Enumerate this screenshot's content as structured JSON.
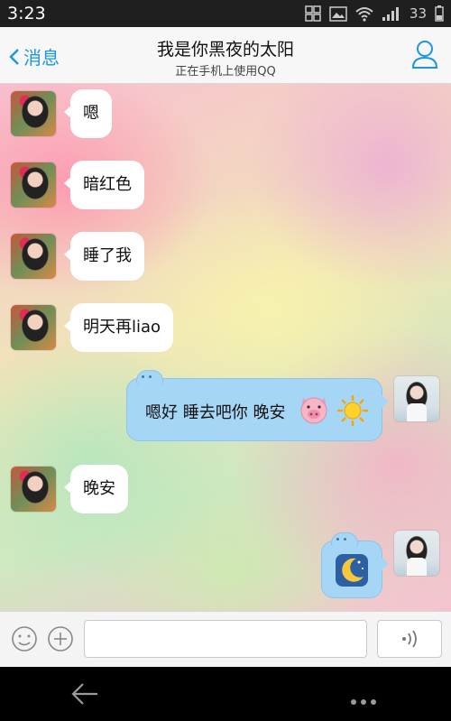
{
  "status_bar": {
    "time": "3:23",
    "battery": "33"
  },
  "header": {
    "back_label": "消息",
    "title": "我是你黑夜的太阳",
    "subtitle": "正在手机上使用QQ",
    "accent_color": "#1b95e0"
  },
  "messages": [
    {
      "side": "in",
      "text": "嗯"
    },
    {
      "side": "in",
      "text": "暗红色"
    },
    {
      "side": "in",
      "text": "睡了我"
    },
    {
      "side": "in",
      "text": "明天再liao"
    },
    {
      "side": "out",
      "text": "嗯好 睡去吧你 晚安",
      "emojis": [
        "pig-face",
        "sun"
      ]
    },
    {
      "side": "in",
      "text": "晚安"
    },
    {
      "side": "out",
      "text": "",
      "emojis": [
        "crescent-moon"
      ]
    }
  ],
  "input_bar": {
    "text_value": "",
    "placeholder": ""
  },
  "colors": {
    "outgoing_bubble": "#a6d6f6",
    "incoming_bubble": "#ffffff"
  }
}
